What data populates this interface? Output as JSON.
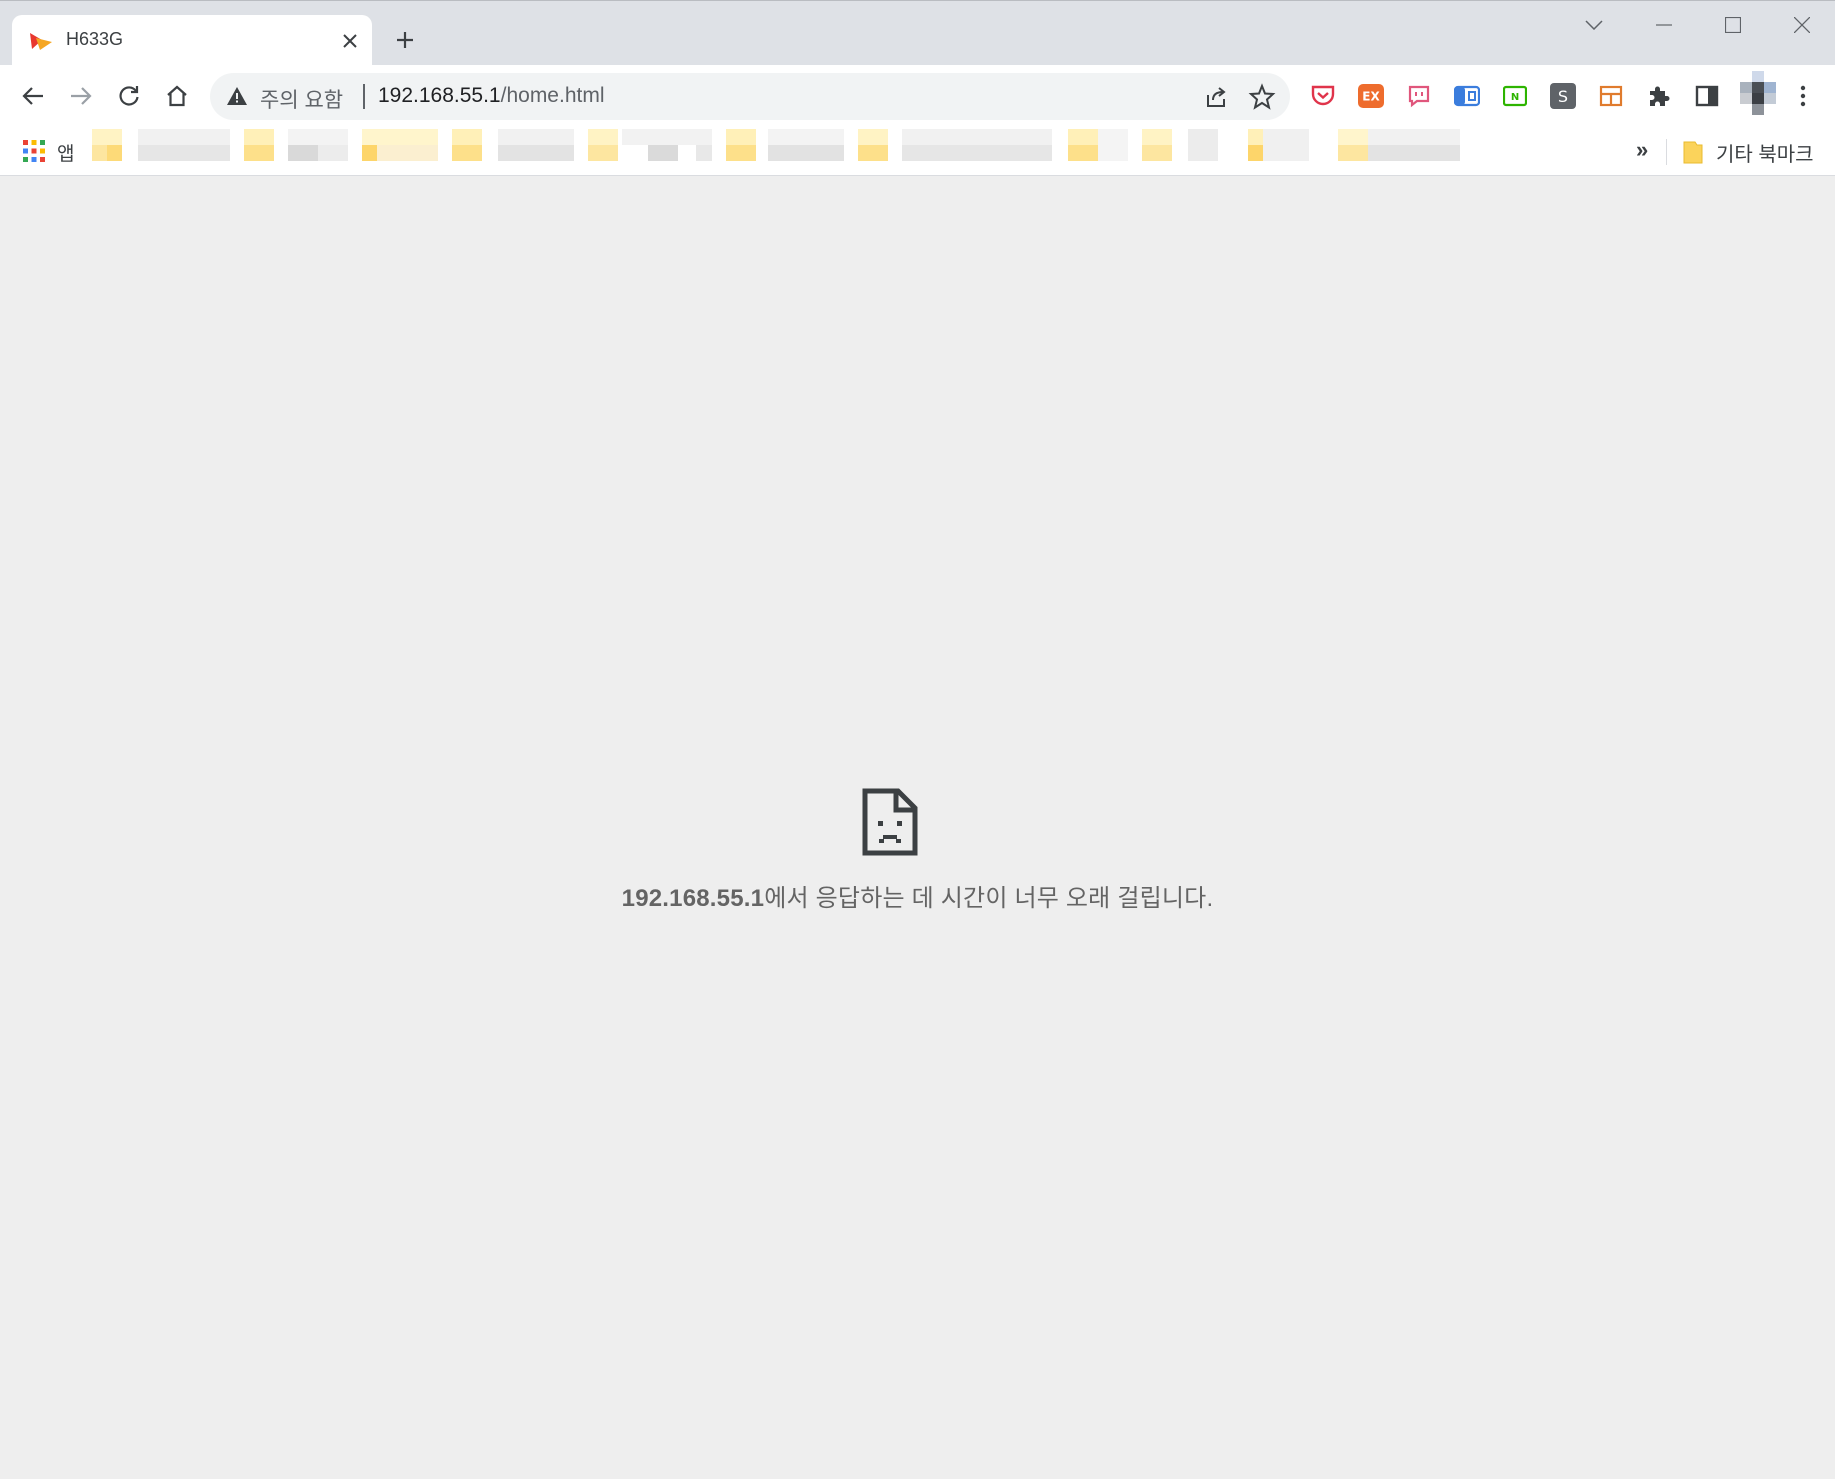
{
  "tab": {
    "title": "H633G",
    "favicon": "sk-broadband-favicon"
  },
  "toolbar": {
    "back_icon": "arrow-left-icon",
    "forward_icon": "arrow-right-icon",
    "reload_icon": "reload-icon",
    "home_icon": "home-icon"
  },
  "omnibox": {
    "security_label": "주의 요함",
    "url_host": "192.168.55.1",
    "url_path": "/home.html"
  },
  "extensions": [
    {
      "name": "pocket-icon",
      "color": "#e0344b"
    },
    {
      "name": "ex-extension-icon",
      "label": "EX",
      "color": "#ee6c2d"
    },
    {
      "name": "chat-extension-icon",
      "color": "#e0567c"
    },
    {
      "name": "translate-extension-icon",
      "color": "#3b7ddd"
    },
    {
      "name": "naver-extension-icon",
      "label": "N",
      "color": "#2db400"
    },
    {
      "name": "s-extension-icon",
      "label": "S",
      "color": "#5f6368"
    },
    {
      "name": "layout-extension-icon",
      "color": "#e07b2d"
    },
    {
      "name": "puzzle-icon",
      "color": "#5f6368"
    },
    {
      "name": "side-panel-icon",
      "color": "#3c4043"
    }
  ],
  "bookmarks": {
    "apps_label": "앱",
    "more": "»",
    "other_label": "기타 북마크"
  },
  "error": {
    "host": "192.168.55.1",
    "message": "에서 응답하는 데 시간이 너무 오래 걸립니다."
  },
  "colors": {
    "accent_folder": "#fbd35b",
    "page_bg": "#eeeeee",
    "tabstrip_bg": "#dee1e6"
  }
}
